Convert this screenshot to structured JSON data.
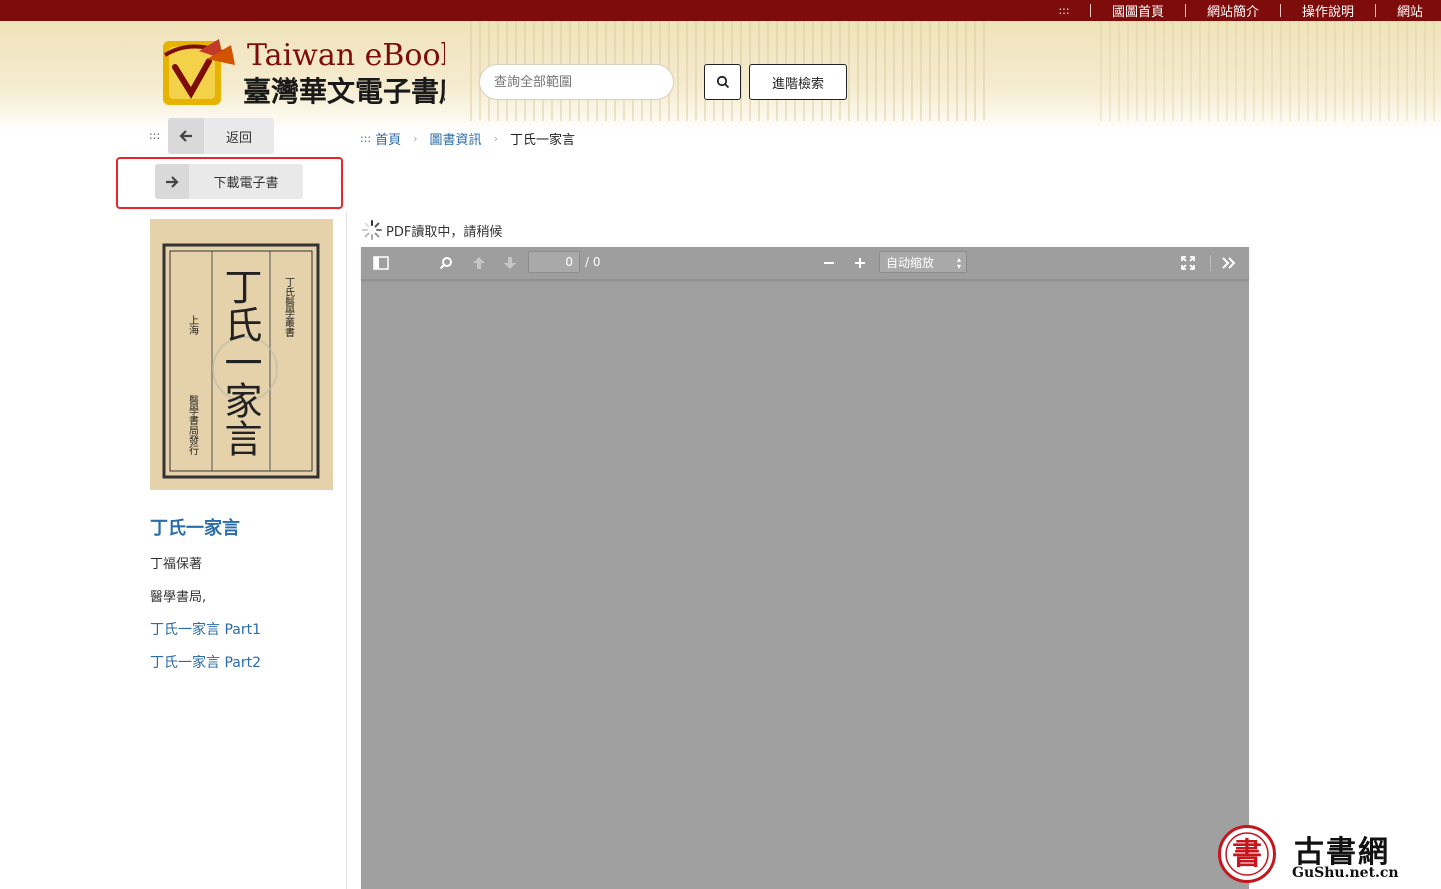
{
  "topnav": {
    "accesskey": ":::",
    "links": [
      "國圖首頁",
      "網站簡介",
      "操作說明",
      "網站"
    ]
  },
  "header": {
    "logo_en": "Taiwan eBook",
    "logo_zh": "臺灣華文電子書庫",
    "search_placeholder": "查詢全部範圍",
    "advanced_search": "進階檢索"
  },
  "left": {
    "accesskey": ":::",
    "back_label": "返回",
    "download_label": "下載電子書",
    "book_title": "丁氏一家言",
    "author": "丁福保著",
    "publisher": "醫學書局,",
    "parts": [
      "丁氏一家言 Part1",
      "丁氏一家言 Part2"
    ]
  },
  "cover": {
    "title": "丁氏一家言",
    "series": "丁氏醫學叢書",
    "place": "上海",
    "issuer": "醫學書局發行"
  },
  "breadcrumb": {
    "accesskey": ":::",
    "home": "首頁",
    "section": "圖書資訊",
    "current": "丁氏一家言"
  },
  "pdf": {
    "loading_text": "PDF讀取中，請稍候",
    "page_value": "0",
    "page_total": "/ 0",
    "zoom": "自动缩放"
  },
  "watermark": {
    "seal_char": "書",
    "name": "古書網",
    "url": "GuShu.net.cn"
  }
}
